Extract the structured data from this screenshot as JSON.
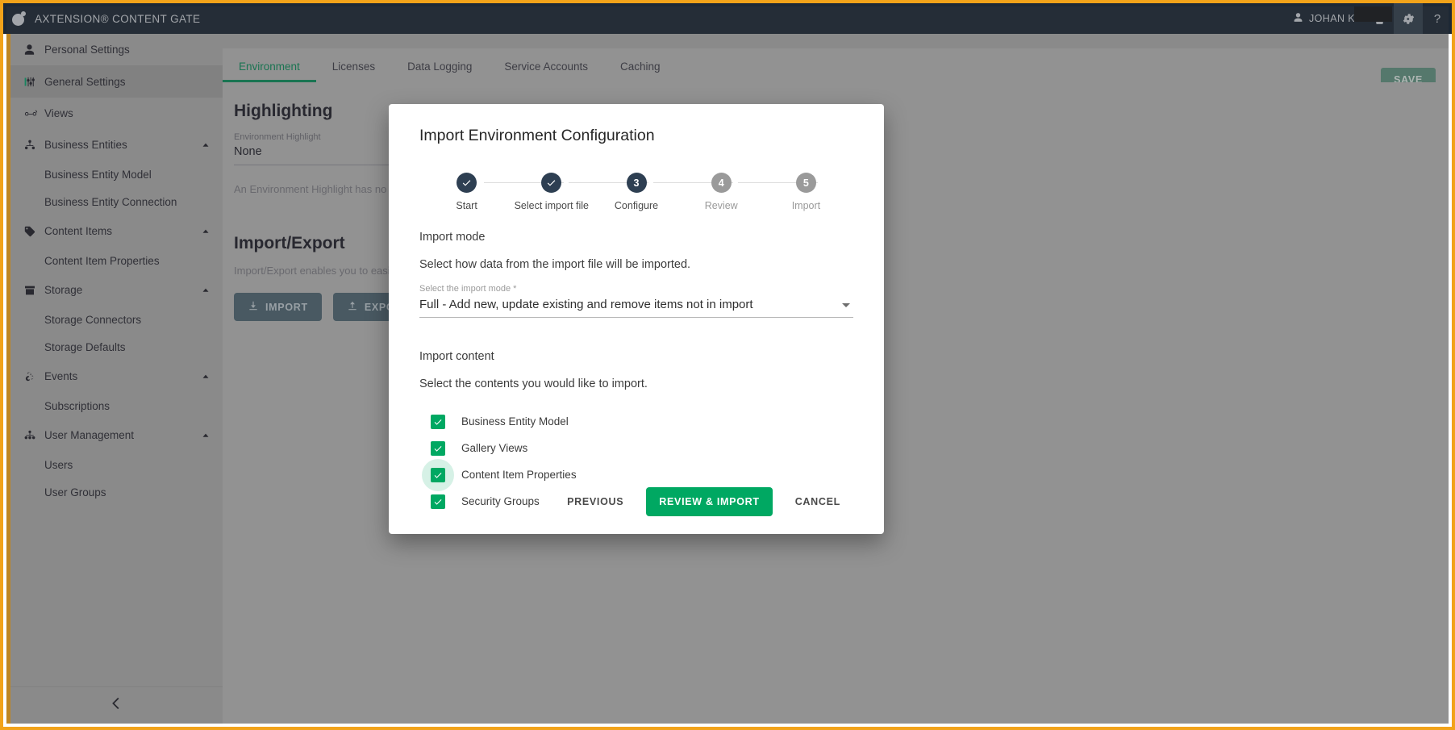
{
  "app": {
    "title": "AXTENSION® CONTENT GATE",
    "logo_icon": "axtension-logo-icon"
  },
  "topbar": {
    "user_label": "JOHAN K",
    "user_icon": "person-icon",
    "clipboard_icon": "clipboard-icon",
    "gear_icon": "gear-icon",
    "help_icon": "question-mark-icon"
  },
  "sidebar": {
    "collapse_icon": "chevron-left-icon",
    "items": [
      {
        "label": "Personal Settings",
        "icon": "person-icon",
        "type": "item",
        "active": false,
        "expandable": false
      },
      {
        "label": "General Settings",
        "icon": "sliders-icon",
        "type": "item",
        "active": true,
        "expandable": false
      },
      {
        "label": "Views",
        "icon": "glasses-icon",
        "type": "item",
        "active": false,
        "expandable": false
      },
      {
        "label": "Business Entities",
        "icon": "hierarchy-icon",
        "type": "item",
        "active": false,
        "expandable": true
      },
      {
        "label": "Business Entity Model",
        "type": "sub"
      },
      {
        "label": "Business Entity Connection",
        "type": "sub"
      },
      {
        "label": "Content Items",
        "icon": "tag-icon",
        "type": "item",
        "active": false,
        "expandable": true
      },
      {
        "label": "Content Item Properties",
        "type": "sub"
      },
      {
        "label": "Storage",
        "icon": "archive-box-icon",
        "type": "item",
        "active": false,
        "expandable": true
      },
      {
        "label": "Storage Connectors",
        "type": "sub"
      },
      {
        "label": "Storage Defaults",
        "type": "sub"
      },
      {
        "label": "Events",
        "icon": "webhook-icon",
        "type": "item",
        "active": false,
        "expandable": true
      },
      {
        "label": "Subscriptions",
        "type": "sub"
      },
      {
        "label": "User Management",
        "icon": "users-group-icon",
        "type": "item",
        "active": false,
        "expandable": true
      },
      {
        "label": "Users",
        "type": "sub"
      },
      {
        "label": "User Groups",
        "type": "sub"
      }
    ]
  },
  "main": {
    "tabs": [
      {
        "label": "Environment",
        "active": true
      },
      {
        "label": "Licenses",
        "active": false
      },
      {
        "label": "Data Logging",
        "active": false
      },
      {
        "label": "Service Accounts",
        "active": false
      },
      {
        "label": "Caching",
        "active": false
      }
    ],
    "save_label": "SAVE",
    "highlighting": {
      "title": "Highlighting",
      "field_label": "Environment Highlight",
      "field_value": "None",
      "hint": "An Environment Highlight has no function"
    },
    "import_export": {
      "title": "Import/Export",
      "description": "Import/Export enables you to easily excha",
      "import_label": "IMPORT",
      "import_icon": "download-icon",
      "export_label": "EXPORT",
      "export_icon": "upload-icon"
    }
  },
  "modal": {
    "title": "Import Environment Configuration",
    "steps": [
      {
        "number": "1",
        "label": "Start",
        "state": "complete"
      },
      {
        "number": "2",
        "label": "Select import file",
        "state": "complete"
      },
      {
        "number": "3",
        "label": "Configure",
        "state": "current"
      },
      {
        "number": "4",
        "label": "Review",
        "state": "pending"
      },
      {
        "number": "5",
        "label": "Import",
        "state": "pending"
      }
    ],
    "import_mode": {
      "heading": "Import mode",
      "description": "Select how data from the import file will be imported.",
      "select_label": "Select the import mode *",
      "select_value": "Full - Add new, update existing and remove items not in import",
      "arrow_icon": "chevron-down-icon"
    },
    "import_content": {
      "heading": "Import content",
      "description": "Select the contents you would like to import.",
      "options": [
        {
          "label": "Business Entity Model",
          "checked": true,
          "focused": false
        },
        {
          "label": "Gallery Views",
          "checked": true,
          "focused": false
        },
        {
          "label": "Content Item Properties",
          "checked": true,
          "focused": true
        },
        {
          "label": "Security Groups",
          "checked": true,
          "focused": false
        }
      ]
    },
    "footer": {
      "previous_label": "PREVIOUS",
      "primary_label": "REVIEW & IMPORT",
      "cancel_label": "CANCEL"
    }
  },
  "colors": {
    "brand_orange": "#f2a31a",
    "accent_green": "#00a862",
    "tab_active_green": "#0d8a5a",
    "topbar_dark": "#1d2835",
    "step_complete": "#2e3f52"
  }
}
